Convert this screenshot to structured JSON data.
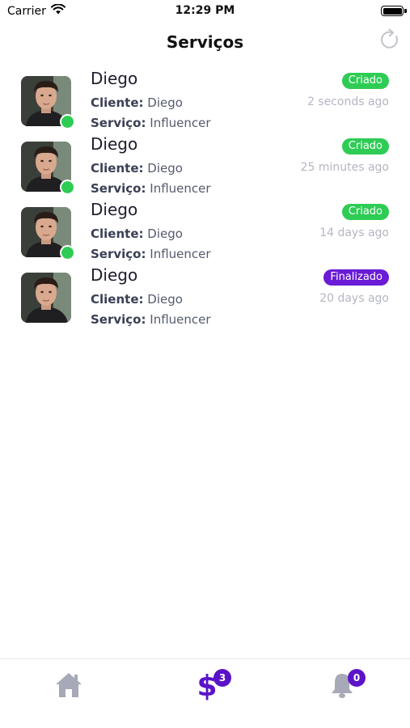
{
  "status_bar": {
    "carrier": "Carrier",
    "time": "12:29 PM"
  },
  "header": {
    "title": "Serviços",
    "refresh_icon": "refresh-icon"
  },
  "labels": {
    "cliente": "Cliente:",
    "servico": "Serviço:"
  },
  "items": [
    {
      "name": "Diego",
      "cliente": "Diego",
      "servico": "Influencer",
      "status": "Criado",
      "time": "2 seconds ago",
      "online": true
    },
    {
      "name": "Diego",
      "cliente": "Diego",
      "servico": "Influencer",
      "status": "Criado",
      "time": "25 minutes ago",
      "online": true
    },
    {
      "name": "Diego",
      "cliente": "Diego",
      "servico": "Influencer",
      "status": "Criado",
      "time": "14 days ago",
      "online": true
    },
    {
      "name": "Diego",
      "cliente": "Diego",
      "servico": "Influencer",
      "status": "Finalizado",
      "time": "20 days ago",
      "online": false
    }
  ],
  "tab_bar": {
    "home_icon": "home-icon",
    "services_icon": "dollar-icon",
    "services_symbol": "$",
    "services_count": "3",
    "notifications_icon": "bell-icon",
    "notifications_count": "0"
  },
  "colors": {
    "status_created": "#2ecc55",
    "status_finished": "#6a1bd6",
    "accent": "#5b13c8",
    "online": "#2ecc55"
  }
}
